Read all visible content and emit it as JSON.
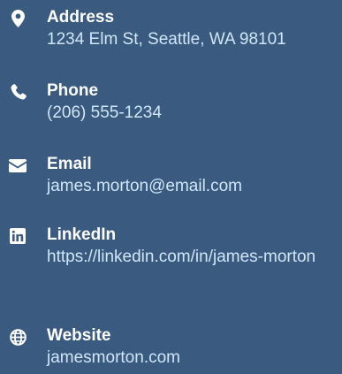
{
  "contacts": [
    {
      "label": "Address",
      "value": "1234 Elm St, Seattle, WA 98101",
      "icon": "map-marker-icon"
    },
    {
      "label": "Phone",
      "value": "(206) 555-1234",
      "icon": "phone-icon"
    },
    {
      "label": "Email",
      "value": "james.morton@email.com",
      "icon": "envelope-icon"
    },
    {
      "label": "LinkedIn",
      "value": "https://linkedin.com/in/james-morton",
      "icon": "linkedin-icon"
    },
    {
      "label": "Website",
      "value": "jamesmorton.com",
      "icon": "globe-icon"
    }
  ],
  "colors": {
    "background": "#3a5a80",
    "label": "#ffffff",
    "value": "#cfe6fb",
    "icon": "#ffffff"
  }
}
